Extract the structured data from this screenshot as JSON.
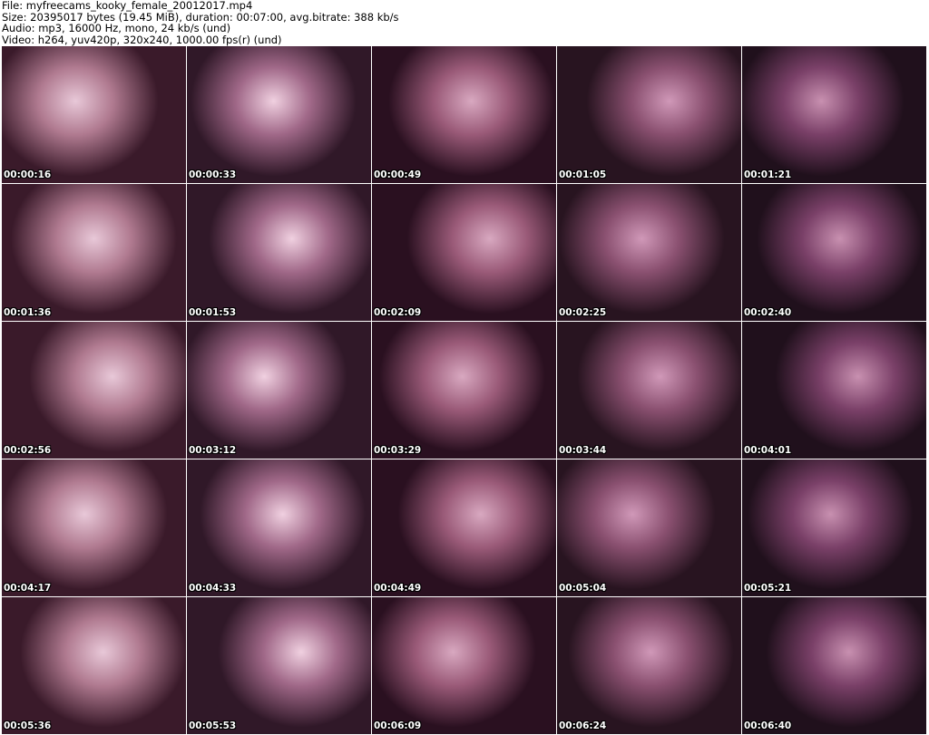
{
  "header": {
    "file": "File: myfreecams_kooky_female_20012017.mp4",
    "size": "Size: 20395017 bytes (19.45 MiB), duration: 00:07:00, avg.bitrate: 388 kb/s",
    "audio": "Audio: mp3, 16000 Hz, mono, 24 kb/s (und)",
    "video": "Video: h264, yuv420p, 320x240, 1000.00 fps(r) (und)"
  },
  "thumbnails": [
    "00:00:16",
    "00:00:33",
    "00:00:49",
    "00:01:05",
    "00:01:21",
    "00:01:36",
    "00:01:53",
    "00:02:09",
    "00:02:25",
    "00:02:40",
    "00:02:56",
    "00:03:12",
    "00:03:29",
    "00:03:44",
    "00:04:01",
    "00:04:17",
    "00:04:33",
    "00:04:49",
    "00:05:04",
    "00:05:21",
    "00:05:36",
    "00:05:53",
    "00:06:09",
    "00:06:24",
    "00:06:40"
  ]
}
